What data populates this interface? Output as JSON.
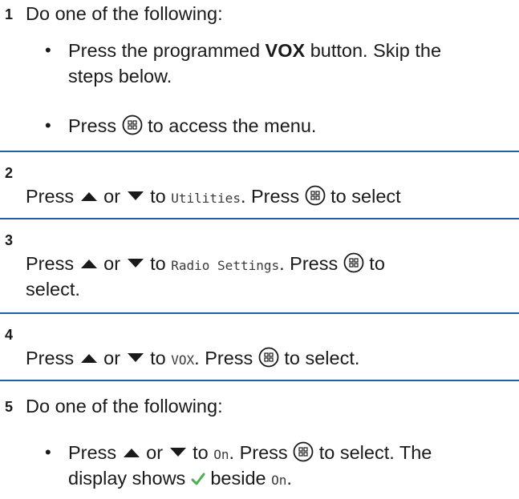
{
  "step1": {
    "number": "1",
    "intro": "Do one of the following:",
    "bullet_a_line1_pre": "Press the programmed ",
    "bullet_a_bold": "VOX",
    "bullet_a_line1_post": " button. Skip the",
    "bullet_a_line2": "steps below.",
    "bullet_b_pre": "Press ",
    "bullet_b_post": " to access the menu."
  },
  "step2": {
    "number": "2",
    "press": "Press ",
    "or": " or ",
    "to": " to ",
    "target": "Utilities",
    "press2": ". Press ",
    "tail": " to select"
  },
  "step3": {
    "number": "3",
    "press": "Press ",
    "or": " or ",
    "to": " to ",
    "target": "Radio Settings",
    "press2": ". Press ",
    "tail": " to",
    "line2": "select."
  },
  "step4": {
    "number": "4",
    "press": "Press ",
    "or": " or ",
    "to": " to ",
    "target": "VOX",
    "press2": ". Press ",
    "tail": " to select."
  },
  "step5": {
    "number": "5",
    "intro": "Do one of the following:",
    "bullet_press": "Press ",
    "bullet_or": " or ",
    "bullet_to": " to ",
    "bullet_target": "On",
    "bullet_press2": ". Press ",
    "bullet_tail": " to select. The",
    "line2_pre": "display shows ",
    "line2_mid": " beside ",
    "line2_target": "On",
    "line2_end": "."
  },
  "colors": {
    "rule": "#1f5fa8",
    "check": "#4caf50"
  },
  "icons": [
    "menu-ok-icon",
    "up-arrow-icon",
    "down-arrow-icon",
    "checkmark-icon"
  ]
}
